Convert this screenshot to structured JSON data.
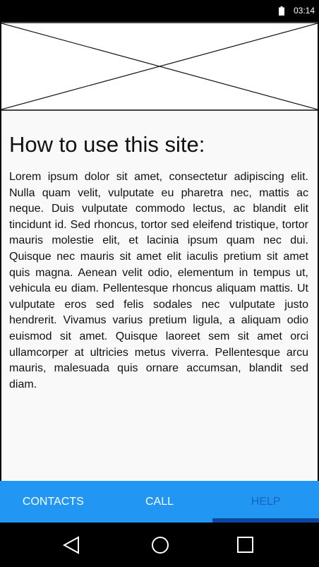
{
  "status_bar": {
    "time": "03:14",
    "icons": [
      "battery-icon"
    ]
  },
  "placeholder": {
    "icon": "image-placeholder-icon"
  },
  "content": {
    "title": "How to use this site:",
    "body": "Lorem ipsum dolor sit amet, consectetur adipiscing elit. Nulla quam velit, vulputate eu pharetra nec, mattis ac neque. Duis vulputate commodo lectus, ac blandit elit tincidunt id. Sed rhoncus, tortor sed eleifend tristique, tortor mauris molestie elit, et lacinia ipsum quam nec dui. Quisque nec mauris sit amet elit iaculis pretium sit amet quis magna. Aenean velit odio, elementum in tempus ut, vehicula eu diam. Pellentesque rhoncus aliquam mattis. Ut vulputate eros sed felis sodales nec vulputate justo hendrerit. Vivamus varius pretium ligula, a aliquam odio euismod sit amet. Quisque laoreet sem sit amet orci ullamcorper at ultricies metus viverra. Pellentesque arcu mauris, malesuada quis ornare accumsan, blandit sed diam."
  },
  "tabs": [
    {
      "label": "CONTACTS",
      "active": false
    },
    {
      "label": "CALL",
      "active": false
    },
    {
      "label": "HELP",
      "active": true
    }
  ],
  "colors": {
    "tab_bar": "#2196f3",
    "active_tab_text": "#1565c0",
    "active_indicator": "#0d47a1"
  },
  "nav_bar": {
    "icons": [
      "back-icon",
      "home-icon",
      "recents-icon"
    ]
  }
}
